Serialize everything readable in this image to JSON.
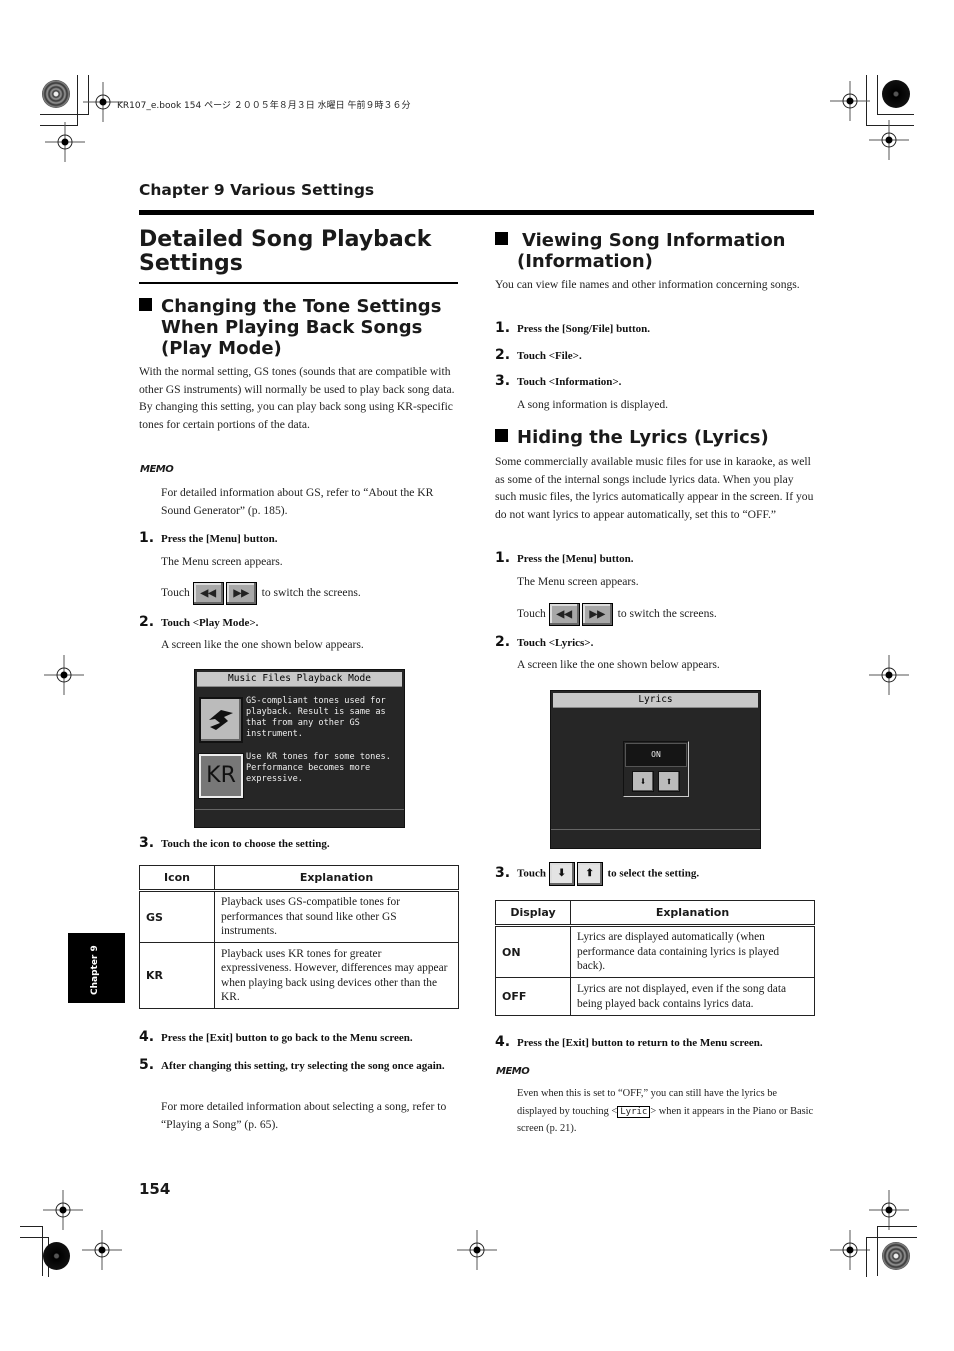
{
  "print_header": "KR107_e.book  154 ページ  ２００５年８月３日  水曜日  午前９時３６分",
  "chapter_heading": "Chapter 9 Various Settings",
  "side_tab": "Chapter 9",
  "page_number": "154",
  "main_title": "Detailed Song Playback Settings",
  "left": {
    "section_title_line1": "Changing the Tone Settings",
    "section_title_line2": "When Playing Back Songs",
    "section_title_line3": "(Play Mode)",
    "intro": "With the normal setting, GS tones (sounds that are compatible with other GS instruments) will normally be used to play back song data. By changing this setting, you can play back song using KR-specific tones for certain portions of the data.",
    "memo_label": "MEMO",
    "memo_text": "For detailed information about GS, refer to “About the KR Sound Generator” (p. 185).",
    "steps": [
      {
        "num": "1.",
        "text": "Press the [Menu] button.",
        "note": "The Menu screen appears."
      },
      {
        "num": "2.",
        "text": "Touch <Play Mode>.",
        "note": "A screen like the one shown below appears."
      },
      {
        "num": "3.",
        "text": "Touch the icon to choose the setting."
      },
      {
        "num": "4.",
        "text": "Press the [Exit] button to go back to the Menu screen."
      },
      {
        "num": "5.",
        "text": "After changing this setting, try selecting the song once again.",
        "note": "For more detailed information about selecting a song, refer to “Playing a Song” (p. 65)."
      }
    ],
    "touch_prefix": "Touch",
    "touch_suffix": "to switch the screens.",
    "prev_icon": "◀◀",
    "next_icon": "▶▶",
    "screen": {
      "title": "Music Files Playback Mode",
      "gs_icon_label": "GS",
      "gs_text": "GS-compliant tones used for playback. Result is same as that from any other GS instrument.",
      "kr_icon_label": "KR",
      "kr_text": "Use KR tones for some tones. Performance becomes more expressive."
    },
    "table": {
      "headers": [
        "Icon",
        "Explanation"
      ],
      "rows": [
        {
          "key": "GS",
          "desc": "Playback uses GS-compatible tones for performances that sound like other GS instruments."
        },
        {
          "key": "KR",
          "desc": "Playback uses KR tones for greater expressiveness. However, differences may appear when playing back using devices other than the KR."
        }
      ]
    }
  },
  "right": {
    "info_title_line1": "Viewing Song Information",
    "info_title_line2": "(Information)",
    "info_intro": "You can view file names and other information concerning songs.",
    "info_steps": [
      {
        "num": "1.",
        "text": "Press the [Song/File] button."
      },
      {
        "num": "2.",
        "text": "Touch <File>."
      },
      {
        "num": "3.",
        "text": "Touch <Information>.",
        "note": "A song information is displayed."
      }
    ],
    "lyrics_title": "Hiding the Lyrics (Lyrics)",
    "lyrics_intro": "Some commercially available music files for use in karaoke, as well as some of the internal songs include lyrics data. When you play such music files, the lyrics automatically appear in the screen. If you do not want lyrics to appear automatically, set this to “OFF.”",
    "lyrics_steps": [
      {
        "num": "1.",
        "text": "Press the [Menu] button.",
        "note": "The Menu screen appears."
      },
      {
        "num": "2.",
        "text": "Touch <Lyrics>.",
        "note": "A screen like the one shown below appears."
      },
      {
        "num": "3.",
        "text_prefix": "Touch",
        "text": "to select the setting."
      },
      {
        "num": "4.",
        "text": "Press the [Exit] button to return to the Menu screen."
      }
    ],
    "touch_prefix": "Touch",
    "touch_suffix": "to switch the screens.",
    "prev_icon": "◀◀",
    "next_icon": "▶▶",
    "down_icon": "⬇",
    "up_icon": "⬆",
    "screen": {
      "title": "Lyrics",
      "value": "ON"
    },
    "table": {
      "headers": [
        "Display",
        "Explanation"
      ],
      "rows": [
        {
          "key": "ON",
          "desc": "Lyrics are displayed automatically (when performance data containing lyrics is played back)."
        },
        {
          "key": "OFF",
          "desc": "Lyrics are not displayed, even if the song data being played back contains lyrics data."
        }
      ]
    },
    "memo_label": "MEMO",
    "memo_part1": "Even when this is set to “OFF,” you can still have the lyrics be displayed by touching <",
    "memo_key": "Lyric",
    "memo_part2": "> when it appears in the Piano or Basic screen (p. 21)."
  }
}
